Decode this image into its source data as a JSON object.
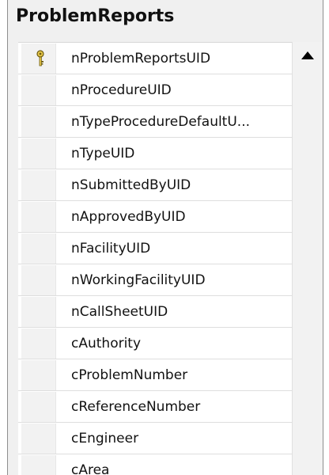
{
  "table": {
    "title": "ProblemReports",
    "columns": [
      {
        "name": "nProblemReportsUID",
        "primary_key": true
      },
      {
        "name": "nProcedureUID"
      },
      {
        "name": "nTypeProcedureDefaultU..."
      },
      {
        "name": "nTypeUID"
      },
      {
        "name": "nSubmittedByUID"
      },
      {
        "name": "nApprovedByUID"
      },
      {
        "name": "nFacilityUID"
      },
      {
        "name": "nWorkingFacilityUID"
      },
      {
        "name": "nCallSheetUID"
      },
      {
        "name": "cAuthority"
      },
      {
        "name": "cProblemNumber"
      },
      {
        "name": "cReferenceNumber"
      },
      {
        "name": "cEngineer"
      },
      {
        "name": "cArea"
      }
    ]
  },
  "icons": {
    "primary_key": "key-icon",
    "scroll_up": "triangle-up-icon"
  },
  "colors": {
    "background": "#f0f0f0",
    "grid_background": "#ffffff",
    "key_gold": "#d9b52a"
  }
}
